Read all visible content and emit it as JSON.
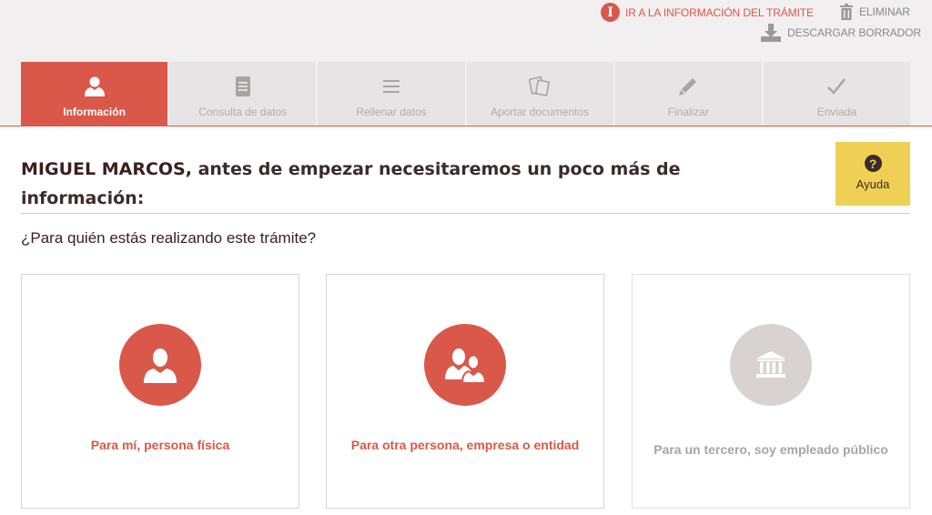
{
  "header": {
    "info_link": "IR A LA INFORMACIÓN DEL TRÁMITE",
    "delete": "ELIMINAR",
    "download": "DESCARGAR BORRADOR"
  },
  "steps": [
    {
      "label": "Información",
      "icon": "user-icon",
      "active": true
    },
    {
      "label": "Consulta de datos",
      "icon": "document-icon",
      "active": false
    },
    {
      "label": "Rellenar datos",
      "icon": "menu-lines-icon",
      "active": false
    },
    {
      "label": "Aportar documentos",
      "icon": "documents-icon",
      "active": false
    },
    {
      "label": "Finalizar",
      "icon": "pencil-icon",
      "active": false
    },
    {
      "label": "Enviada",
      "icon": "check-icon",
      "active": false
    }
  ],
  "main": {
    "user_name": "MIGUEL MARCOS,",
    "heading_rest": " antes de empezar necesitaremos un poco más de información:",
    "help_label": "Ayuda",
    "question": "¿Para quién estás realizando este trámite?"
  },
  "options": [
    {
      "label": "Para mí, persona física",
      "icon": "person-icon",
      "enabled": true
    },
    {
      "label": "Para otra persona, empresa o entidad",
      "icon": "people-icon",
      "enabled": true
    },
    {
      "label": "Para un tercero, soy empleado público",
      "icon": "institution-icon",
      "enabled": false
    }
  ],
  "colors": {
    "accent": "#d9584a",
    "help": "#f0cf55",
    "disabled": "#d9d2d2"
  }
}
